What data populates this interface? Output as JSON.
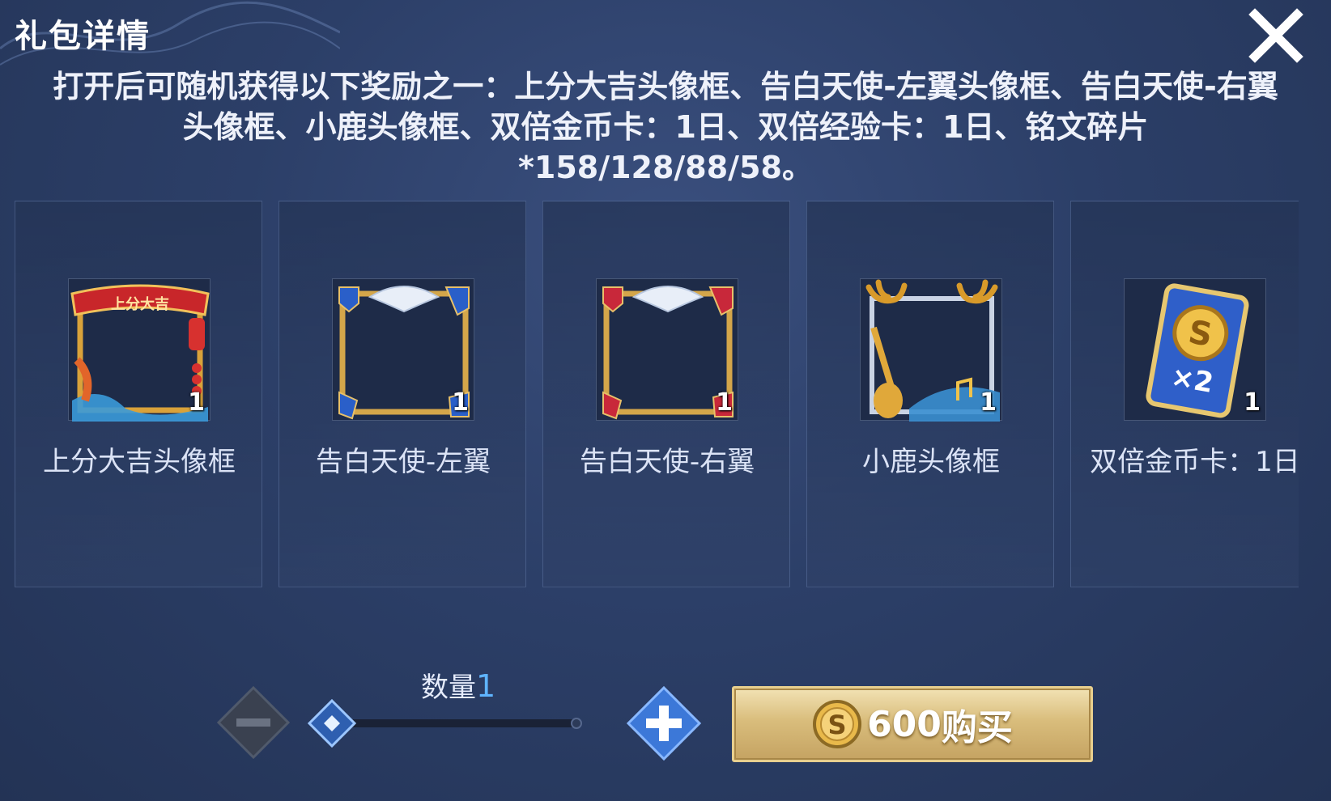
{
  "dialog": {
    "title": "礼包详情",
    "description": "打开后可随机获得以下奖励之一：上分大吉头像框、告白天使-左翼头像框、告白天使-右翼头像框、小鹿头像框、双倍金币卡：1日、双倍经验卡：1日、铭文碎片*158/128/88/58。"
  },
  "rewards": [
    {
      "name": "上分大吉头像框",
      "count": "1",
      "icon": "frame-lucky-icon",
      "banner_text": "上分大吉"
    },
    {
      "name": "告白天使-左翼",
      "count": "1",
      "icon": "frame-angel-left-icon"
    },
    {
      "name": "告白天使-右翼",
      "count": "1",
      "icon": "frame-angel-right-icon"
    },
    {
      "name": "小鹿头像框",
      "count": "1",
      "icon": "frame-deer-icon"
    },
    {
      "name": "双倍金币卡：1日",
      "count": "1",
      "icon": "double-gold-card-icon",
      "card_text": "×2"
    }
  ],
  "quantity": {
    "label": "数量",
    "value": "1",
    "slider_fraction": 0
  },
  "purchase": {
    "price": "600",
    "action": "购买",
    "currency_icon": "gold-coin-icon"
  },
  "colors": {
    "background": "#2c3f68",
    "accent_blue": "#5fb4ff",
    "buy_gold": "#d9bd7c"
  }
}
